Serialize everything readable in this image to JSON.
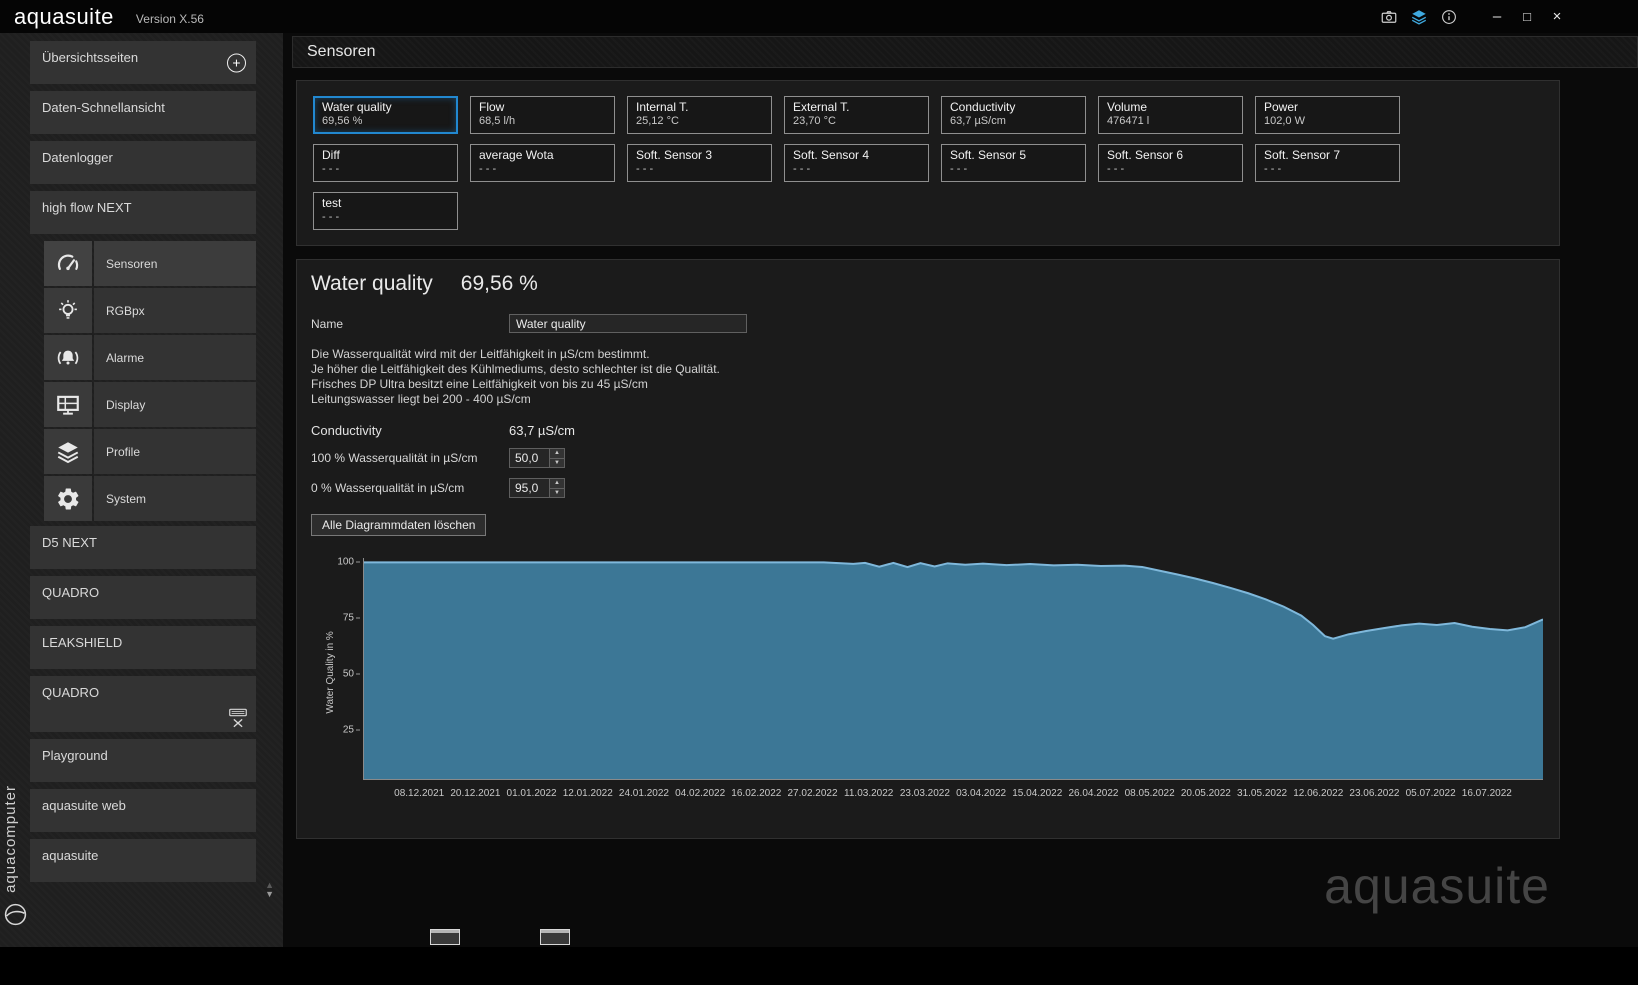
{
  "titlebar": {
    "logo": "aquasuite",
    "version": "Version X.56",
    "icons": [
      "screenshot-icon",
      "profiles-icon",
      "info-icon"
    ],
    "window_controls": {
      "minimize": "–",
      "maximize": "□",
      "close": "×"
    }
  },
  "sidebar": {
    "brand_vertical": "aquacomputer",
    "add_button": "+",
    "items": [
      {
        "label": "Übersichtsseiten"
      },
      {
        "label": "Daten-Schnellansicht"
      },
      {
        "label": "Datenlogger"
      },
      {
        "label": "high flow NEXT"
      },
      {
        "label": "D5 NEXT"
      },
      {
        "label": "QUADRO"
      },
      {
        "label": "LEAKSHIELD"
      },
      {
        "label": "QUADRO"
      },
      {
        "label": "Playground"
      },
      {
        "label": "aquasuite web"
      },
      {
        "label": "aquasuite"
      }
    ],
    "subitems": [
      {
        "label": "Sensoren",
        "icon": "gauge-icon",
        "selected": true
      },
      {
        "label": "RGBpx",
        "icon": "bulb-icon",
        "selected": false
      },
      {
        "label": "Alarme",
        "icon": "bell-icon",
        "selected": false
      },
      {
        "label": "Display",
        "icon": "display-icon",
        "selected": false
      },
      {
        "label": "Profile",
        "icon": "layers-icon",
        "selected": false
      },
      {
        "label": "System",
        "icon": "gear-icon",
        "selected": false
      }
    ]
  },
  "main": {
    "header": "Sensoren",
    "tiles": [
      {
        "name": "Water quality",
        "value": "69,56 %",
        "selected": true
      },
      {
        "name": "Flow",
        "value": "68,5 l/h",
        "selected": false
      },
      {
        "name": "Internal T.",
        "value": "25,12 °C",
        "selected": false
      },
      {
        "name": "External T.",
        "value": "23,70 °C",
        "selected": false
      },
      {
        "name": "Conductivity",
        "value": "63,7 µS/cm",
        "selected": false
      },
      {
        "name": "Volume",
        "value": "476471 l",
        "selected": false
      },
      {
        "name": "Power",
        "value": "102,0 W",
        "selected": false
      },
      {
        "name": "Diff",
        "value": "- - -",
        "selected": false
      },
      {
        "name": "average Wota",
        "value": "- - -",
        "selected": false
      },
      {
        "name": "Soft. Sensor 3",
        "value": "- - -",
        "selected": false
      },
      {
        "name": "Soft. Sensor 4",
        "value": "- - -",
        "selected": false
      },
      {
        "name": "Soft. Sensor 5",
        "value": "- - -",
        "selected": false
      },
      {
        "name": "Soft. Sensor 6",
        "value": "- - -",
        "selected": false
      },
      {
        "name": "Soft. Sensor 7",
        "value": "- - -",
        "selected": false
      },
      {
        "name": "test",
        "value": "- - -",
        "selected": false
      }
    ],
    "detail": {
      "title": "Water quality",
      "title_value": "69,56 %",
      "name_label": "Name",
      "name_value": "Water quality",
      "description_lines": [
        "Die Wasserqualität wird mit der Leitfähigkeit in µS/cm bestimmt.",
        "Je höher die Leitfähigkeit des Kühlmediums, desto schlechter ist die Qualität.",
        "Frisches DP Ultra besitzt eine Leitfähigkeit von bis zu 45 µS/cm",
        "Leitungswasser liegt bei 200 - 400 µS/cm"
      ],
      "conductivity_label": "Conductivity",
      "conductivity_value": "63,7 µS/cm",
      "wq100_label": "100 % Wasserqualität in µS/cm",
      "wq100_value": "50,0",
      "wq0_label": "0 % Wasserqualität in µS/cm",
      "wq0_value": "95,0",
      "clear_button": "Alle Diagrammdaten löschen"
    },
    "watermark": "aquasuite"
  },
  "chart_data": {
    "type": "area",
    "title": "",
    "xlabel": "",
    "ylabel": "Water Quality in %",
    "yticks": [
      100,
      75,
      50,
      25
    ],
    "ylim": [
      3,
      102
    ],
    "grid": false,
    "legend": "none",
    "fill_color": "#3c7796",
    "line_color": "#7fb8db",
    "x_labels": [
      "08.12.2021",
      "20.12.2021",
      "01.01.2022",
      "12.01.2022",
      "24.01.2022",
      "04.02.2022",
      "16.02.2022",
      "27.02.2022",
      "11.03.2022",
      "23.03.2022",
      "03.04.2022",
      "15.04.2022",
      "26.04.2022",
      "08.05.2022",
      "20.05.2022",
      "31.05.2022",
      "12.06.2022",
      "23.06.2022",
      "05.07.2022",
      "16.07.2022"
    ],
    "series": [
      {
        "name": "Water Quality",
        "points": [
          [
            0.0,
            100
          ],
          [
            0.05,
            100
          ],
          [
            0.1,
            100
          ],
          [
            0.15,
            100
          ],
          [
            0.2,
            100
          ],
          [
            0.25,
            100
          ],
          [
            0.3,
            100
          ],
          [
            0.35,
            100
          ],
          [
            0.39,
            100
          ],
          [
            0.415,
            99.4
          ],
          [
            0.425,
            99.8
          ],
          [
            0.437,
            98.1
          ],
          [
            0.449,
            99.8
          ],
          [
            0.461,
            97.9
          ],
          [
            0.472,
            99.7
          ],
          [
            0.484,
            98.2
          ],
          [
            0.495,
            99.6
          ],
          [
            0.51,
            99.0
          ],
          [
            0.525,
            99.5
          ],
          [
            0.545,
            98.8
          ],
          [
            0.565,
            99.3
          ],
          [
            0.585,
            98.7
          ],
          [
            0.605,
            99.0
          ],
          [
            0.625,
            98.4
          ],
          [
            0.645,
            98.6
          ],
          [
            0.66,
            98.0
          ],
          [
            0.675,
            96.3
          ],
          [
            0.69,
            94.6
          ],
          [
            0.705,
            92.8
          ],
          [
            0.72,
            90.8
          ],
          [
            0.735,
            88.6
          ],
          [
            0.75,
            86.2
          ],
          [
            0.765,
            83.4
          ],
          [
            0.78,
            80.2
          ],
          [
            0.795,
            76.2
          ],
          [
            0.805,
            72.0
          ],
          [
            0.815,
            67.0
          ],
          [
            0.822,
            65.8
          ],
          [
            0.835,
            67.8
          ],
          [
            0.85,
            69.3
          ],
          [
            0.865,
            70.6
          ],
          [
            0.88,
            71.8
          ],
          [
            0.895,
            72.6
          ],
          [
            0.91,
            72.0
          ],
          [
            0.925,
            72.9
          ],
          [
            0.94,
            71.2
          ],
          [
            0.955,
            70.2
          ],
          [
            0.97,
            69.6
          ],
          [
            0.985,
            71.0
          ],
          [
            1.0,
            74.5
          ]
        ]
      }
    ]
  }
}
